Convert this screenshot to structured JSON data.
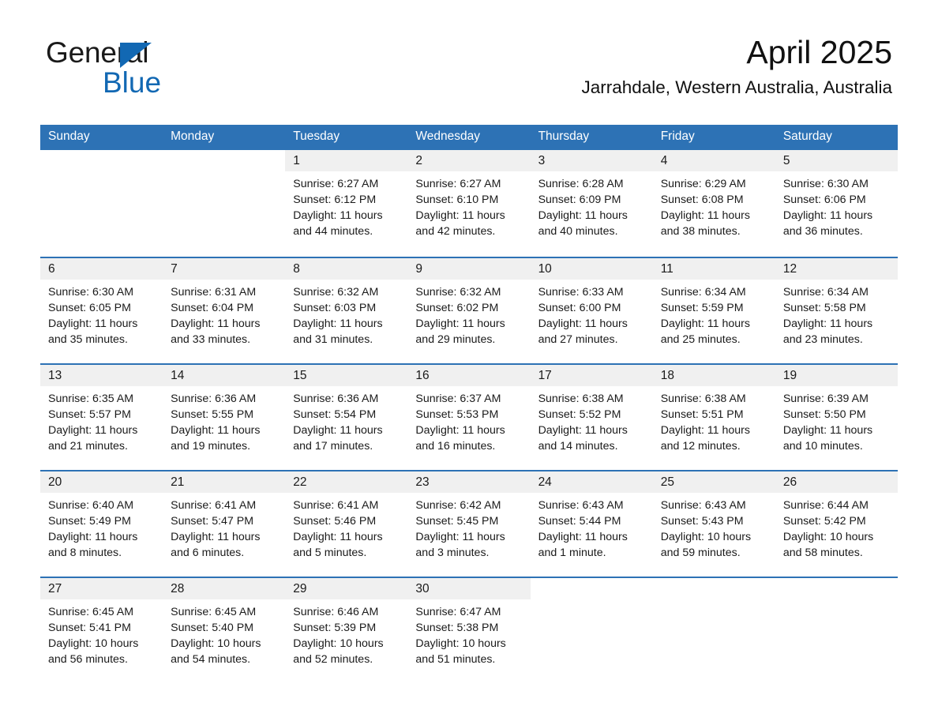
{
  "brand": {
    "word_one": "General",
    "word_two": "Blue",
    "triangle_icon": "blue-triangle-icon"
  },
  "header": {
    "month_title": "April 2025",
    "location": "Jarrahdale, Western Australia, Australia"
  },
  "colors": {
    "header_blue": "#2d72b5",
    "brand_blue": "#1268b3",
    "day_strip_gray": "#f0f0f0",
    "text": "#1a1a1a",
    "page_background": "#ffffff"
  },
  "calendar": {
    "weekdays": [
      "Sunday",
      "Monday",
      "Tuesday",
      "Wednesday",
      "Thursday",
      "Friday",
      "Saturday"
    ],
    "weeks": [
      [
        {
          "day": "",
          "blank": true,
          "lines": []
        },
        {
          "day": "",
          "blank": true,
          "lines": []
        },
        {
          "day": "1",
          "lines": [
            "Sunrise: 6:27 AM",
            "Sunset: 6:12 PM",
            "Daylight: 11 hours",
            "and 44 minutes."
          ]
        },
        {
          "day": "2",
          "lines": [
            "Sunrise: 6:27 AM",
            "Sunset: 6:10 PM",
            "Daylight: 11 hours",
            "and 42 minutes."
          ]
        },
        {
          "day": "3",
          "lines": [
            "Sunrise: 6:28 AM",
            "Sunset: 6:09 PM",
            "Daylight: 11 hours",
            "and 40 minutes."
          ]
        },
        {
          "day": "4",
          "lines": [
            "Sunrise: 6:29 AM",
            "Sunset: 6:08 PM",
            "Daylight: 11 hours",
            "and 38 minutes."
          ]
        },
        {
          "day": "5",
          "lines": [
            "Sunrise: 6:30 AM",
            "Sunset: 6:06 PM",
            "Daylight: 11 hours",
            "and 36 minutes."
          ]
        }
      ],
      [
        {
          "day": "6",
          "lines": [
            "Sunrise: 6:30 AM",
            "Sunset: 6:05 PM",
            "Daylight: 11 hours",
            "and 35 minutes."
          ]
        },
        {
          "day": "7",
          "lines": [
            "Sunrise: 6:31 AM",
            "Sunset: 6:04 PM",
            "Daylight: 11 hours",
            "and 33 minutes."
          ]
        },
        {
          "day": "8",
          "lines": [
            "Sunrise: 6:32 AM",
            "Sunset: 6:03 PM",
            "Daylight: 11 hours",
            "and 31 minutes."
          ]
        },
        {
          "day": "9",
          "lines": [
            "Sunrise: 6:32 AM",
            "Sunset: 6:02 PM",
            "Daylight: 11 hours",
            "and 29 minutes."
          ]
        },
        {
          "day": "10",
          "lines": [
            "Sunrise: 6:33 AM",
            "Sunset: 6:00 PM",
            "Daylight: 11 hours",
            "and 27 minutes."
          ]
        },
        {
          "day": "11",
          "lines": [
            "Sunrise: 6:34 AM",
            "Sunset: 5:59 PM",
            "Daylight: 11 hours",
            "and 25 minutes."
          ]
        },
        {
          "day": "12",
          "lines": [
            "Sunrise: 6:34 AM",
            "Sunset: 5:58 PM",
            "Daylight: 11 hours",
            "and 23 minutes."
          ]
        }
      ],
      [
        {
          "day": "13",
          "lines": [
            "Sunrise: 6:35 AM",
            "Sunset: 5:57 PM",
            "Daylight: 11 hours",
            "and 21 minutes."
          ]
        },
        {
          "day": "14",
          "lines": [
            "Sunrise: 6:36 AM",
            "Sunset: 5:55 PM",
            "Daylight: 11 hours",
            "and 19 minutes."
          ]
        },
        {
          "day": "15",
          "lines": [
            "Sunrise: 6:36 AM",
            "Sunset: 5:54 PM",
            "Daylight: 11 hours",
            "and 17 minutes."
          ]
        },
        {
          "day": "16",
          "lines": [
            "Sunrise: 6:37 AM",
            "Sunset: 5:53 PM",
            "Daylight: 11 hours",
            "and 16 minutes."
          ]
        },
        {
          "day": "17",
          "lines": [
            "Sunrise: 6:38 AM",
            "Sunset: 5:52 PM",
            "Daylight: 11 hours",
            "and 14 minutes."
          ]
        },
        {
          "day": "18",
          "lines": [
            "Sunrise: 6:38 AM",
            "Sunset: 5:51 PM",
            "Daylight: 11 hours",
            "and 12 minutes."
          ]
        },
        {
          "day": "19",
          "lines": [
            "Sunrise: 6:39 AM",
            "Sunset: 5:50 PM",
            "Daylight: 11 hours",
            "and 10 minutes."
          ]
        }
      ],
      [
        {
          "day": "20",
          "lines": [
            "Sunrise: 6:40 AM",
            "Sunset: 5:49 PM",
            "Daylight: 11 hours",
            "and 8 minutes."
          ]
        },
        {
          "day": "21",
          "lines": [
            "Sunrise: 6:41 AM",
            "Sunset: 5:47 PM",
            "Daylight: 11 hours",
            "and 6 minutes."
          ]
        },
        {
          "day": "22",
          "lines": [
            "Sunrise: 6:41 AM",
            "Sunset: 5:46 PM",
            "Daylight: 11 hours",
            "and 5 minutes."
          ]
        },
        {
          "day": "23",
          "lines": [
            "Sunrise: 6:42 AM",
            "Sunset: 5:45 PM",
            "Daylight: 11 hours",
            "and 3 minutes."
          ]
        },
        {
          "day": "24",
          "lines": [
            "Sunrise: 6:43 AM",
            "Sunset: 5:44 PM",
            "Daylight: 11 hours",
            "and 1 minute."
          ]
        },
        {
          "day": "25",
          "lines": [
            "Sunrise: 6:43 AM",
            "Sunset: 5:43 PM",
            "Daylight: 10 hours",
            "and 59 minutes."
          ]
        },
        {
          "day": "26",
          "lines": [
            "Sunrise: 6:44 AM",
            "Sunset: 5:42 PM",
            "Daylight: 10 hours",
            "and 58 minutes."
          ]
        }
      ],
      [
        {
          "day": "27",
          "lines": [
            "Sunrise: 6:45 AM",
            "Sunset: 5:41 PM",
            "Daylight: 10 hours",
            "and 56 minutes."
          ]
        },
        {
          "day": "28",
          "lines": [
            "Sunrise: 6:45 AM",
            "Sunset: 5:40 PM",
            "Daylight: 10 hours",
            "and 54 minutes."
          ]
        },
        {
          "day": "29",
          "lines": [
            "Sunrise: 6:46 AM",
            "Sunset: 5:39 PM",
            "Daylight: 10 hours",
            "and 52 minutes."
          ]
        },
        {
          "day": "30",
          "lines": [
            "Sunrise: 6:47 AM",
            "Sunset: 5:38 PM",
            "Daylight: 10 hours",
            "and 51 minutes."
          ]
        },
        {
          "day": "",
          "blank": true,
          "lines": []
        },
        {
          "day": "",
          "blank": true,
          "lines": []
        },
        {
          "day": "",
          "blank": true,
          "lines": []
        }
      ]
    ]
  }
}
